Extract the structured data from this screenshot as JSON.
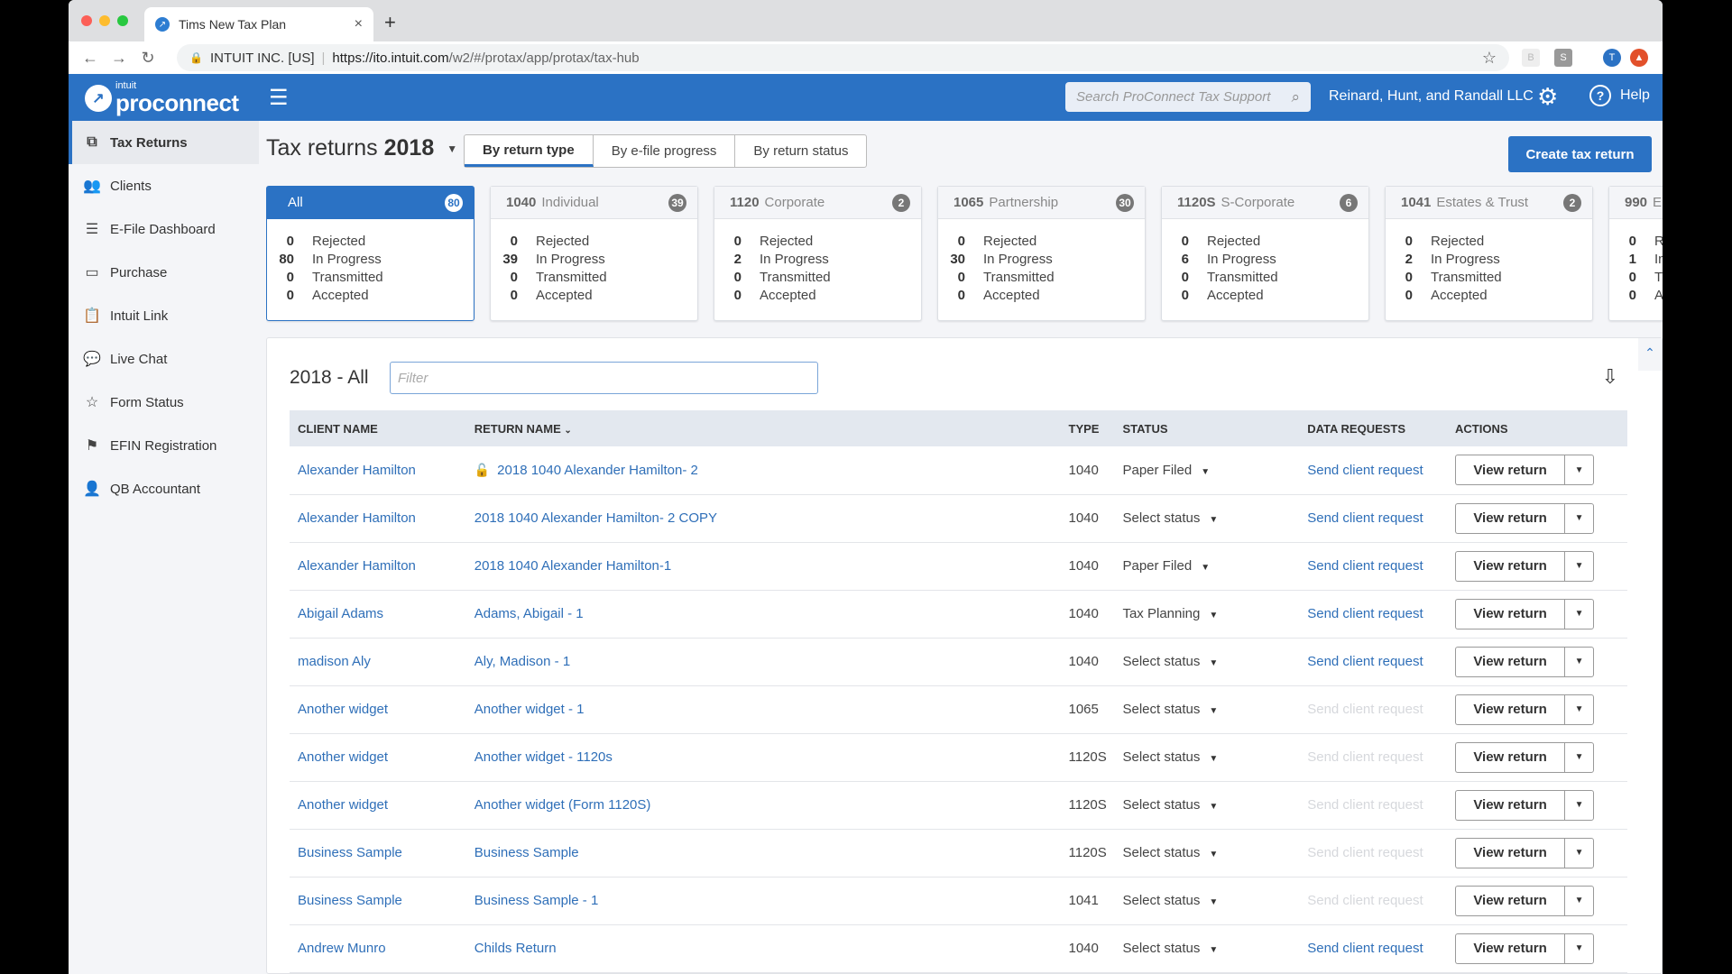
{
  "browser": {
    "tab_title": "Tims New Tax Plan",
    "security_label": "INTUIT INC. [US]",
    "url_host": "https://ito.intuit.com",
    "url_path": "/w2/#/protax/app/protax/tax-hub"
  },
  "header": {
    "logo_small": "intuit",
    "logo_big": "proconnect",
    "search_placeholder": "Search ProConnect Tax Support",
    "org_name": "Reinard, Hunt, and Randall LLC",
    "help_label": "Help"
  },
  "sidebar": {
    "items": [
      {
        "label": "Tax Returns",
        "icon": "tax-returns-icon",
        "glyph": "⧉",
        "active": true
      },
      {
        "label": "Clients",
        "icon": "clients-icon",
        "glyph": "👥"
      },
      {
        "label": "E-File Dashboard",
        "icon": "list-icon",
        "glyph": "☰"
      },
      {
        "label": "Purchase",
        "icon": "card-icon",
        "glyph": "▭"
      },
      {
        "label": "Intuit Link",
        "icon": "clipboard-icon",
        "glyph": "📋"
      },
      {
        "label": "Live Chat",
        "icon": "chat-icon",
        "glyph": "💬"
      },
      {
        "label": "Form Status",
        "icon": "star-icon",
        "glyph": "☆"
      },
      {
        "label": "EFIN Registration",
        "icon": "flag-icon",
        "glyph": "⚑"
      },
      {
        "label": "QB Accountant",
        "icon": "accountant-icon",
        "glyph": "👤"
      }
    ]
  },
  "main": {
    "title_prefix": "Tax returns",
    "title_year": "2018",
    "segments": [
      "By return type",
      "By e-file progress",
      "By return status"
    ],
    "create_button": "Create tax return",
    "status_labels": [
      "Rejected",
      "In Progress",
      "Transmitted",
      "Accepted"
    ],
    "cards": [
      {
        "code": "",
        "name": "All",
        "count": "80",
        "values": [
          "0",
          "80",
          "0",
          "0"
        ]
      },
      {
        "code": "1040",
        "name": "Individual",
        "count": "39",
        "values": [
          "0",
          "39",
          "0",
          "0"
        ]
      },
      {
        "code": "1120",
        "name": "Corporate",
        "count": "2",
        "values": [
          "0",
          "2",
          "0",
          "0"
        ]
      },
      {
        "code": "1065",
        "name": "Partnership",
        "count": "30",
        "values": [
          "0",
          "30",
          "0",
          "0"
        ]
      },
      {
        "code": "1120S",
        "name": "S-Corporate",
        "count": "6",
        "values": [
          "0",
          "6",
          "0",
          "0"
        ]
      },
      {
        "code": "1041",
        "name": "Estates & Trust",
        "count": "2",
        "values": [
          "0",
          "2",
          "0",
          "0"
        ]
      },
      {
        "code": "990",
        "name": "E",
        "count": "",
        "values": [
          "0",
          "1",
          "0",
          "0"
        ]
      }
    ],
    "list_title": "2018 - All",
    "filter_placeholder": "Filter",
    "columns": [
      "CLIENT NAME",
      "RETURN NAME",
      "TYPE",
      "STATUS",
      "DATA REQUESTS",
      "ACTIONS"
    ],
    "view_label": "View return",
    "request_label": "Send client request",
    "rows": [
      {
        "client": "Alexander Hamilton",
        "return": "2018 1040 Alexander Hamilton- 2",
        "locked": true,
        "type": "1040",
        "status": "Paper Filed",
        "request_enabled": true
      },
      {
        "client": "Alexander Hamilton",
        "return": "2018 1040 Alexander Hamilton- 2 COPY",
        "type": "1040",
        "status": "Select status",
        "request_enabled": true
      },
      {
        "client": "Alexander Hamilton",
        "return": "2018 1040 Alexander Hamilton-1",
        "type": "1040",
        "status": "Paper Filed",
        "request_enabled": true
      },
      {
        "client": "Abigail Adams",
        "return": "Adams, Abigail - 1",
        "type": "1040",
        "status": "Tax Planning",
        "request_enabled": true
      },
      {
        "client": "madison Aly",
        "return": "Aly, Madison - 1",
        "type": "1040",
        "status": "Select status",
        "request_enabled": true
      },
      {
        "client": "Another widget",
        "return": "Another widget - 1",
        "type": "1065",
        "status": "Select status",
        "request_enabled": false
      },
      {
        "client": "Another widget",
        "return": "Another widget - 1120s",
        "type": "1120S",
        "status": "Select status",
        "request_enabled": false
      },
      {
        "client": "Another widget",
        "return": "Another widget (Form 1120S)",
        "type": "1120S",
        "status": "Select status",
        "request_enabled": false
      },
      {
        "client": "Business Sample",
        "return": "Business Sample",
        "type": "1120S",
        "status": "Select status",
        "request_enabled": false
      },
      {
        "client": "Business Sample",
        "return": "Business Sample - 1",
        "type": "1041",
        "status": "Select status",
        "request_enabled": false
      },
      {
        "client": "Andrew Munro",
        "return": "Childs Return",
        "type": "1040",
        "status": "Select status",
        "request_enabled": true
      }
    ]
  },
  "colors": {
    "brand": "#2b72c4",
    "link": "#2f6fb8"
  }
}
